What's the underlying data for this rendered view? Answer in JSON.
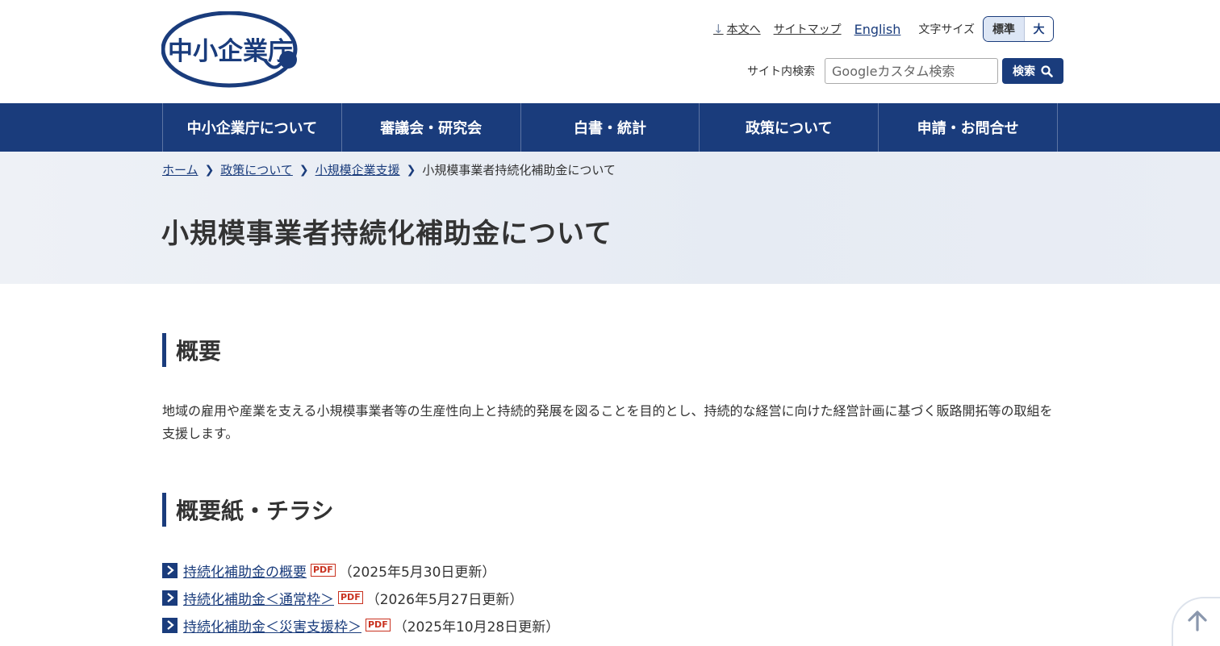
{
  "header": {
    "logo_text": "中小企業庁",
    "skip_link": "本文へ",
    "sitemap": "サイトマップ",
    "english": "English",
    "font_size_label": "文字サイズ",
    "font_size_standard": "標準",
    "font_size_large": "大",
    "search_label": "サイト内検索",
    "search_placeholder": "Googleカスタム検索",
    "search_button": "検索"
  },
  "nav": {
    "items": [
      {
        "label": "中小企業庁について"
      },
      {
        "label": "審議会・研究会"
      },
      {
        "label": "白書・統計"
      },
      {
        "label": "政策について"
      },
      {
        "label": "申請・お問合せ"
      }
    ]
  },
  "breadcrumb": {
    "items": [
      {
        "label": "ホーム"
      },
      {
        "label": "政策について"
      },
      {
        "label": "小規模企業支援"
      }
    ],
    "current": "小規模事業者持続化補助金について"
  },
  "page_title": "小規模事業者持続化補助金について",
  "sections": [
    {
      "heading": "概要",
      "text": "地域の雇用や産業を支える小規模事業者等の生産性向上と持続的発展を図ることを目的とし、持続的な経営に向けた経営計画に基づく販路開拓等の取組を支援します。"
    },
    {
      "heading": "概要紙・チラシ",
      "items": [
        {
          "label": "持続化補助金の概要",
          "badge": "PDF",
          "date": "（2025年5月30日更新）"
        },
        {
          "label": "持続化補助金＜通常枠＞",
          "badge": "PDF",
          "date": "（2026年5月27日更新）"
        },
        {
          "label": "持続化補助金＜災害支援枠＞",
          "badge": "PDF",
          "date": "（2025年10月28日更新）"
        }
      ]
    }
  ],
  "colors": {
    "brand": "#1a3c7c",
    "pdf_badge": "#c9311f",
    "title_band": "#e9edf4"
  }
}
